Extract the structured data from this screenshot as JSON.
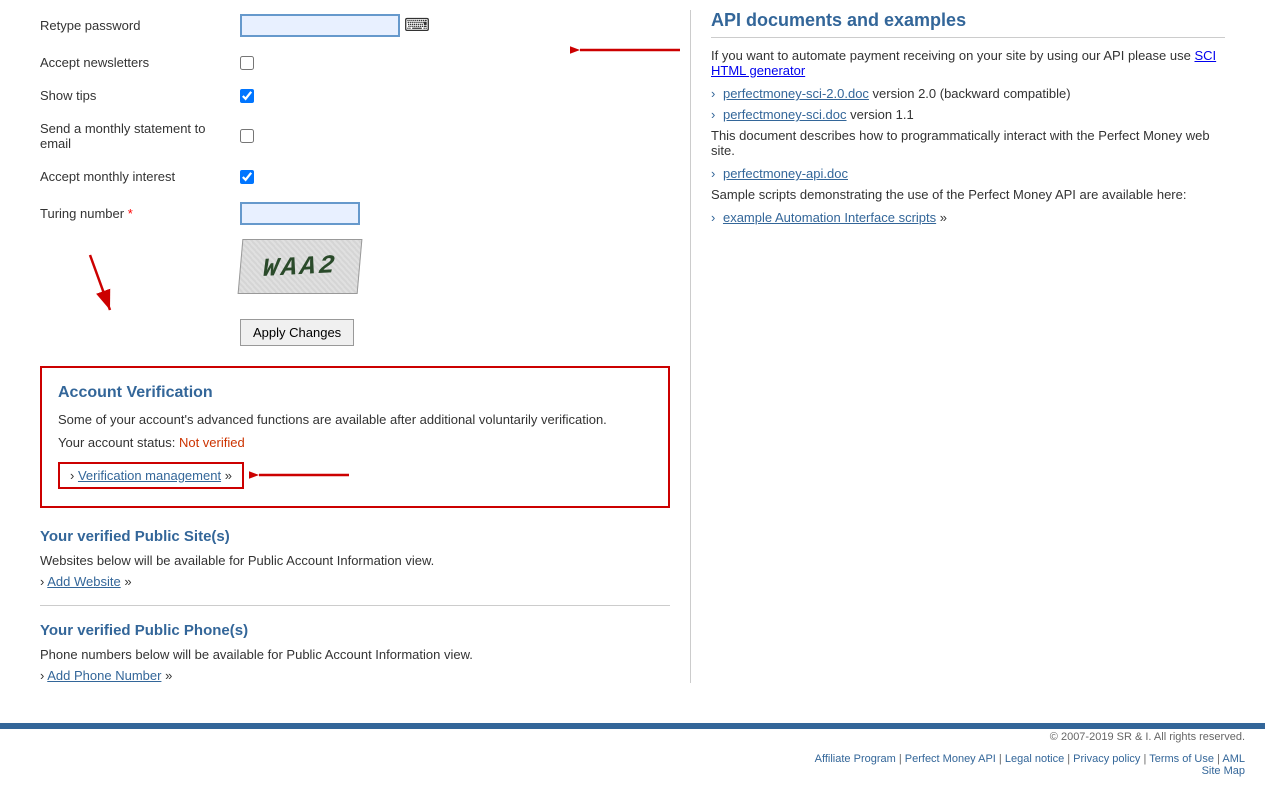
{
  "form": {
    "retype_password_label": "Retype password",
    "accept_newsletters_label": "Accept newsletters",
    "show_tips_label": "Show tips",
    "send_statement_label": "Send a monthly statement to email",
    "accept_interest_label": "Accept monthly interest",
    "turing_label": "Turing number",
    "required_marker": "*",
    "accept_newsletters_checked": false,
    "show_tips_checked": true,
    "send_statement_checked": false,
    "accept_interest_checked": true,
    "apply_button": "Apply Changes"
  },
  "verification": {
    "title": "Account Verification",
    "description": "Some of your account's advanced functions are available after additional voluntarily verification.",
    "status_label": "Your account status:",
    "status_value": "Not verified",
    "link_prefix": "›",
    "link_text": "Verification management",
    "link_suffix": "»"
  },
  "public_sites": {
    "title": "Your verified Public Site(s)",
    "description": "Websites below will be available for Public Account Information view.",
    "link_prefix": "›",
    "link_text": "Add Website",
    "link_suffix": "»"
  },
  "public_phones": {
    "title": "Your verified Public Phone(s)",
    "description": "Phone numbers below will be available for Public Account Information view.",
    "link_prefix": "›",
    "link_text": "Add Phone Number",
    "link_suffix": "»"
  },
  "api": {
    "title": "API documents and examples",
    "description": "If you want to automate payment receiving on your site by using our API please use",
    "link1_text": "SCI HTML generator",
    "doc1_link": "perfectmoney-sci-2.0.doc",
    "doc1_desc": "version 2.0 (backward compatible)",
    "doc2_link": "perfectmoney-sci.doc",
    "doc2_desc": "version 1.1",
    "doc3_desc": "This document describes how to programmatically interact with the Perfect Money web site.",
    "doc4_link": "perfectmoney-api.doc",
    "sample_desc": "Sample scripts demonstrating the use of the Perfect Money API are available here:",
    "example_link": "example Automation Interface scripts",
    "example_suffix": "»"
  },
  "footer": {
    "copyright": "© 2007-2019 SR & I. All rights reserved.",
    "links": [
      "Affiliate Program",
      "Perfect Money API",
      "Legal notice",
      "Privacy policy",
      "Terms of Use",
      "AML",
      "Site Map"
    ]
  }
}
